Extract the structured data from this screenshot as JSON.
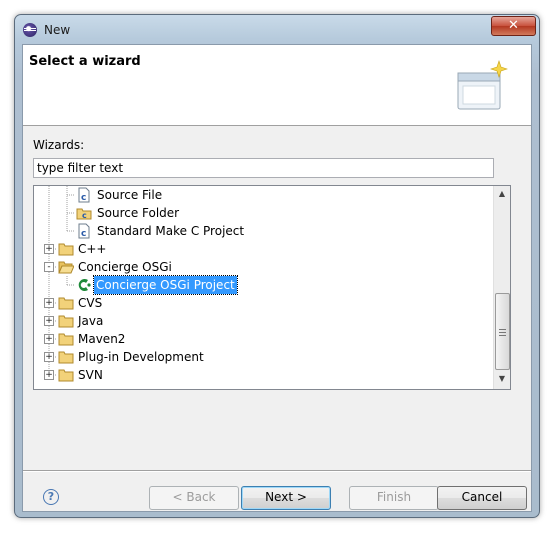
{
  "window": {
    "title": "New"
  },
  "banner": {
    "title": "Select a wizard"
  },
  "filter": {
    "label": "Wizards:",
    "value": "type filter text"
  },
  "tree": {
    "items": [
      {
        "label": "Source File",
        "icon": "c-source-file-icon",
        "selected": false
      },
      {
        "label": "Source Folder",
        "icon": "source-folder-icon",
        "selected": false
      },
      {
        "label": "Standard Make C Project",
        "icon": "c-project-icon",
        "selected": false
      },
      {
        "label": "C++",
        "icon": "folder-icon",
        "expander": "+",
        "selected": false
      },
      {
        "label": "Concierge OSGi",
        "icon": "folder-open-icon",
        "expander": "-",
        "selected": false
      },
      {
        "label": "Concierge OSGi Project",
        "icon": "concierge-icon",
        "selected": true
      },
      {
        "label": "CVS",
        "icon": "folder-icon",
        "expander": "+",
        "selected": false
      },
      {
        "label": "Java",
        "icon": "folder-icon",
        "expander": "+",
        "selected": false
      },
      {
        "label": "Maven2",
        "icon": "folder-icon",
        "expander": "+",
        "selected": false
      },
      {
        "label": "Plug-in Development",
        "icon": "folder-icon",
        "expander": "+",
        "selected": false
      },
      {
        "label": "SVN",
        "icon": "folder-icon",
        "expander": "+",
        "selected": false
      }
    ]
  },
  "buttons": {
    "back": "< Back",
    "next": "Next >",
    "finish": "Finish",
    "cancel": "Cancel"
  },
  "colors": {
    "selection": "#3399ff",
    "window_frame": "#aebfd1",
    "close": "#c8513c"
  }
}
